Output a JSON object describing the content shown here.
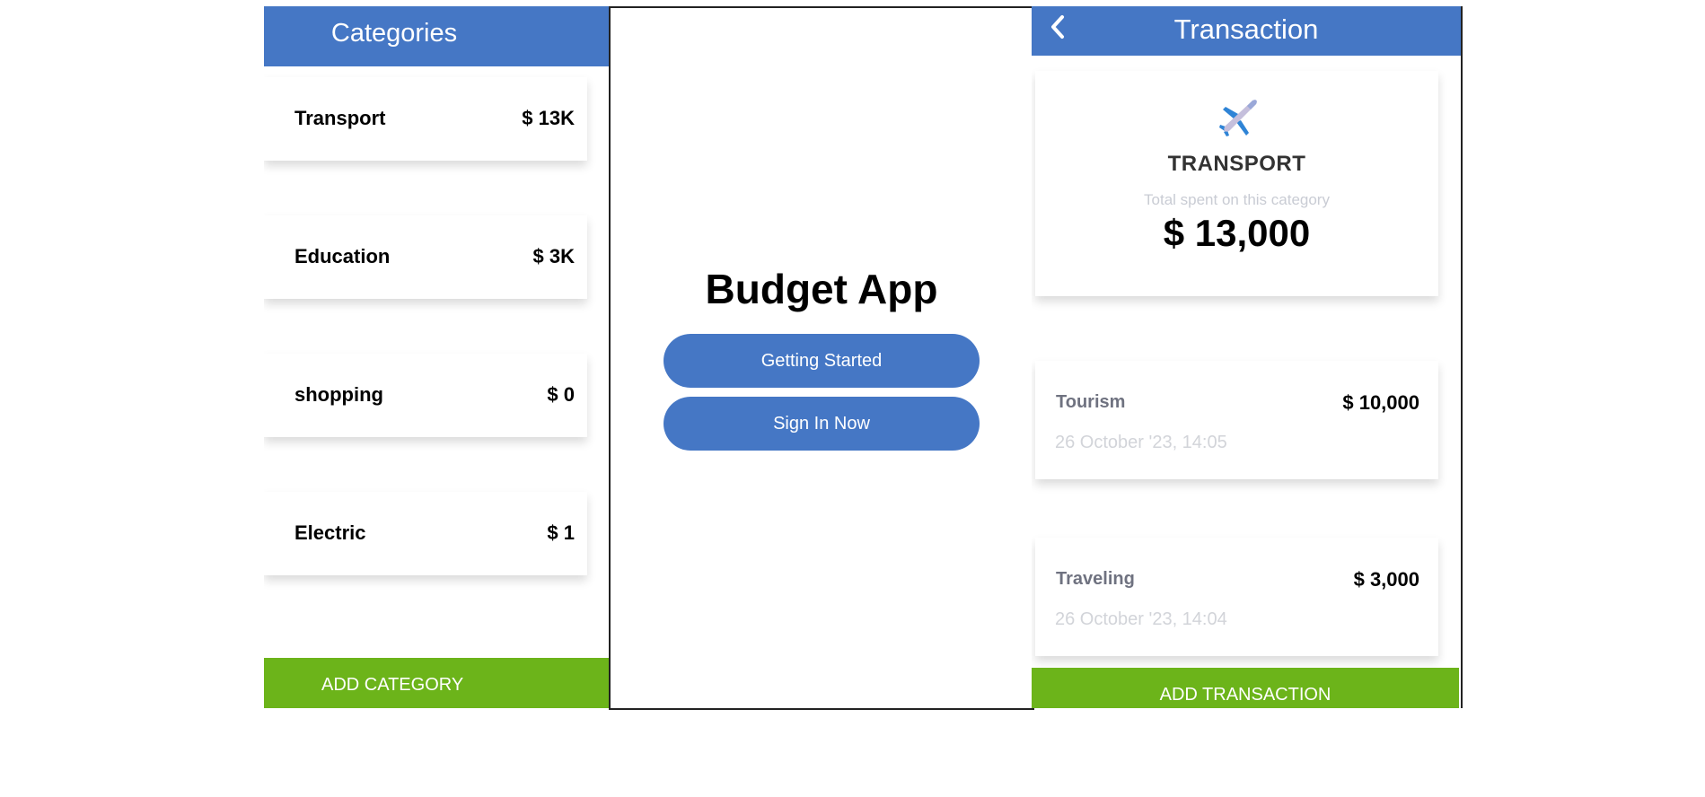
{
  "categories_screen": {
    "title": "Categories",
    "items": [
      {
        "name": "Transport",
        "amount": "$ 13K"
      },
      {
        "name": "Education",
        "amount": "$ 3K"
      },
      {
        "name": "shopping",
        "amount": "$ 0"
      },
      {
        "name": "Electric",
        "amount": "$ 1"
      }
    ],
    "add_button": "ADD CATEGORY"
  },
  "welcome_screen": {
    "app_title": "Budget App",
    "getting_started": "Getting Started",
    "sign_in": "Sign In Now"
  },
  "transaction_screen": {
    "title": "Transaction",
    "back_icon": "chevron-left-icon",
    "category_icon": "airplane-icon",
    "category_name": "TRANSPORT",
    "total_label": "Total spent on this category",
    "total_amount": "$ 13,000",
    "transactions": [
      {
        "name": "Tourism",
        "amount": "$ 10,000",
        "date": "26 October '23, 14:05"
      },
      {
        "name": "Traveling",
        "amount": "$ 3,000",
        "date": "26 October '23, 14:04"
      }
    ],
    "add_button": "ADD TRANSACTION"
  },
  "colors": {
    "header_blue": "#4577c5",
    "action_green": "#6cb41a",
    "muted_text": "#c9ccd4"
  }
}
